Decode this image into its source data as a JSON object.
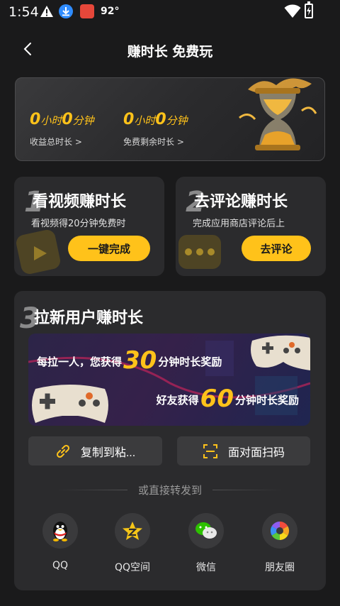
{
  "status_bar": {
    "time": "1:54",
    "temperature": "92°",
    "icons": [
      "warning-icon",
      "download-icon",
      "app-notification-icon",
      "wifi-icon",
      "battery-charging-icon"
    ]
  },
  "header": {
    "title": "赚时长 免费玩",
    "back_icon": "chevron-left-icon"
  },
  "summary": {
    "earned": {
      "hours": "0",
      "hour_unit": "小时",
      "minutes": "0",
      "minute_unit": "分钟",
      "label": "收益总时长 >"
    },
    "remaining": {
      "hours": "0",
      "hour_unit": "小时",
      "minutes": "0",
      "minute_unit": "分钟",
      "label": "免费剩余时长 >"
    },
    "accent_color": "#ffc21a"
  },
  "tasks": [
    {
      "number": "1",
      "title": "看视频赚时长",
      "subtitle": "看视频得20分钟免费时",
      "button": "一键完成"
    },
    {
      "number": "2",
      "title": "去评论赚时长",
      "subtitle": "完成应用商店评论后上",
      "button": "去评论"
    }
  ],
  "invite": {
    "number": "3",
    "title": "拉新用户赚时长",
    "banner": {
      "line1_prefix": "每拉一人，您获得",
      "line1_number": "30",
      "line1_suffix": "分钟时长奖励",
      "line2_prefix": "好友获得",
      "line2_number": "60",
      "line2_suffix": "分钟时长奖励"
    },
    "copy_button": "复制到粘...",
    "scan_button": "面对面扫码",
    "share_label": "或直接转发到",
    "share_targets": [
      {
        "label": "QQ",
        "icon": "qq-penguin-icon"
      },
      {
        "label": "QQ空间",
        "icon": "qzone-star-icon"
      },
      {
        "label": "微信",
        "icon": "wechat-icon"
      },
      {
        "label": "朋友圈",
        "icon": "moments-aperture-icon"
      }
    ]
  }
}
